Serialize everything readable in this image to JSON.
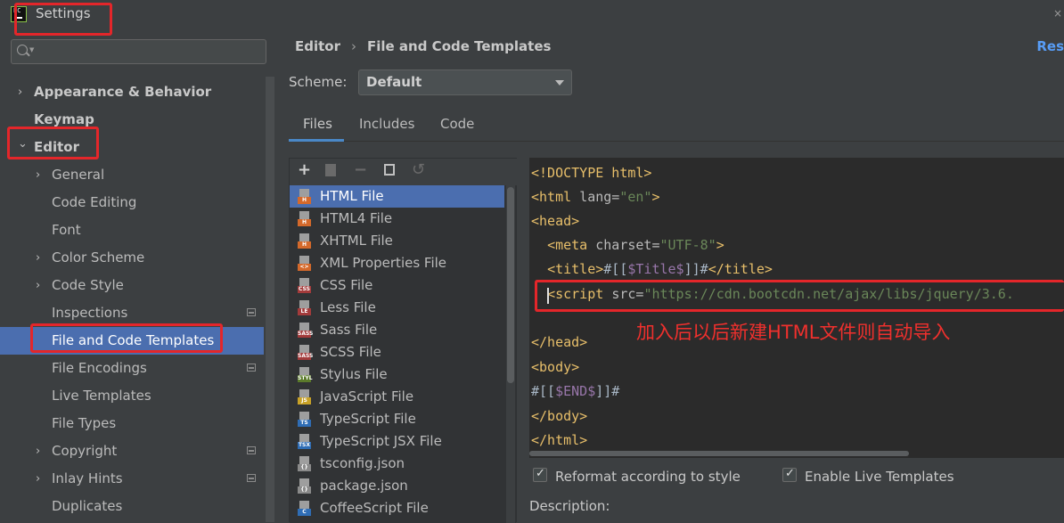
{
  "window": {
    "title": "Settings",
    "close_glyph": "×"
  },
  "sidebar": {
    "search_placeholder": "",
    "items": [
      {
        "label": "Appearance & Behavior",
        "level": 0,
        "bold": true,
        "chevron": "right"
      },
      {
        "label": "Keymap",
        "level": 0,
        "bold": true,
        "chevron": ""
      },
      {
        "label": "Editor",
        "level": 0,
        "bold": true,
        "chevron": "down"
      },
      {
        "label": "General",
        "level": 1,
        "chevron": "right"
      },
      {
        "label": "Code Editing",
        "level": 1,
        "chevron": ""
      },
      {
        "label": "Font",
        "level": 1,
        "chevron": ""
      },
      {
        "label": "Color Scheme",
        "level": 1,
        "chevron": "right"
      },
      {
        "label": "Code Style",
        "level": 1,
        "chevron": "right"
      },
      {
        "label": "Inspections",
        "level": 1,
        "chevron": "",
        "project_icon": true
      },
      {
        "label": "File and Code Templates",
        "level": 1,
        "chevron": "",
        "selected": true
      },
      {
        "label": "File Encodings",
        "level": 1,
        "chevron": "",
        "project_icon": true
      },
      {
        "label": "Live Templates",
        "level": 1,
        "chevron": ""
      },
      {
        "label": "File Types",
        "level": 1,
        "chevron": ""
      },
      {
        "label": "Copyright",
        "level": 1,
        "chevron": "right",
        "project_icon": true
      },
      {
        "label": "Inlay Hints",
        "level": 1,
        "chevron": "right",
        "project_icon": true
      },
      {
        "label": "Duplicates",
        "level": 1,
        "chevron": ""
      }
    ]
  },
  "header": {
    "breadcrumb": [
      "Editor",
      "File and Code Templates"
    ],
    "breadcrumb_sep": "›",
    "reset_label": "Res"
  },
  "scheme": {
    "label": "Scheme:",
    "value": "Default"
  },
  "tabs": [
    {
      "label": "Files",
      "active": true
    },
    {
      "label": "Includes",
      "active": false
    },
    {
      "label": "Code",
      "active": false
    }
  ],
  "toolbar_icons": [
    "add-icon",
    "copy-template-icon",
    "remove-icon",
    "duplicate-icon",
    "reset-icon"
  ],
  "toolbar_glyphs": {
    "add": "+",
    "remove": "−",
    "reset": "↺"
  },
  "files": [
    {
      "name": "HTML File",
      "badge": "H",
      "color": "#d4692b",
      "selected": true
    },
    {
      "name": "HTML4 File",
      "badge": "H",
      "color": "#d4692b"
    },
    {
      "name": "XHTML File",
      "badge": "H",
      "color": "#d4692b"
    },
    {
      "name": "XML Properties File",
      "badge": "<>",
      "color": "#d4692b"
    },
    {
      "name": "CSS File",
      "badge": "CSS",
      "color": "#a33b3b"
    },
    {
      "name": "Less File",
      "badge": "LE",
      "color": "#a33b3b"
    },
    {
      "name": "Sass File",
      "badge": "SASS",
      "color": "#a33b3b"
    },
    {
      "name": "SCSS File",
      "badge": "SASS",
      "color": "#a33b3b"
    },
    {
      "name": "Stylus File",
      "badge": "STYL",
      "color": "#5b7a2b"
    },
    {
      "name": "JavaScript File",
      "badge": "JS",
      "color": "#c9a227"
    },
    {
      "name": "TypeScript File",
      "badge": "TS",
      "color": "#2f6db5"
    },
    {
      "name": "TypeScript JSX File",
      "badge": "TSX",
      "color": "#2f6db5"
    },
    {
      "name": "tsconfig.json",
      "badge": "{}",
      "color": "#8a8a8a"
    },
    {
      "name": "package.json",
      "badge": "{}",
      "color": "#8a8a8a"
    },
    {
      "name": "CoffeeScript File",
      "badge": "C",
      "color": "#2f6db5"
    }
  ],
  "code": {
    "lines": [
      {
        "segments": [
          [
            "tg",
            "<!DOCTYPE html>"
          ]
        ]
      },
      {
        "segments": [
          [
            "tg",
            "<html "
          ],
          [
            "at",
            "lang="
          ],
          [
            "st",
            "\"en\""
          ],
          [
            "tg",
            ">"
          ]
        ]
      },
      {
        "segments": [
          [
            "tg",
            "<head>"
          ]
        ]
      },
      {
        "segments": [
          [
            "tx",
            "  "
          ],
          [
            "tg",
            "<meta "
          ],
          [
            "at",
            "charset="
          ],
          [
            "st",
            "\"UTF-8\""
          ],
          [
            "tg",
            ">"
          ]
        ]
      },
      {
        "segments": [
          [
            "tx",
            "  "
          ],
          [
            "tg",
            "<title>"
          ],
          [
            "tx",
            "#[["
          ],
          [
            "vr",
            "$Title$"
          ],
          [
            "tx",
            "]]#"
          ],
          [
            "tg",
            "</title>"
          ]
        ]
      },
      {
        "segments": [
          [
            "tx",
            "  "
          ],
          [
            "tg",
            "<script "
          ],
          [
            "at",
            "src="
          ],
          [
            "st",
            "\"https://cdn.bootcdn.net/ajax/libs/jquery/3.6."
          ]
        ]
      },
      {
        "segments": [
          [
            "tx",
            ""
          ]
        ]
      },
      {
        "segments": [
          [
            "tg",
            "</head>"
          ]
        ]
      },
      {
        "segments": [
          [
            "tg",
            "<body>"
          ]
        ]
      },
      {
        "segments": [
          [
            "tx",
            "#[["
          ],
          [
            "vr",
            "$END$"
          ],
          [
            "tx",
            "]]#"
          ]
        ]
      },
      {
        "segments": [
          [
            "tg",
            "</body>"
          ]
        ]
      },
      {
        "segments": [
          [
            "tg",
            "</html>"
          ]
        ]
      }
    ],
    "annotation": "加入后以后新建HTML文件则自动导入"
  },
  "options": {
    "reformat_label": "Reformat according to style",
    "live_templates_label": "Enable Live Templates",
    "description_label": "Description:"
  },
  "colors": {
    "accent": "#4b6eaf",
    "highlight_box": "#e4262a",
    "link": "#589df6"
  }
}
